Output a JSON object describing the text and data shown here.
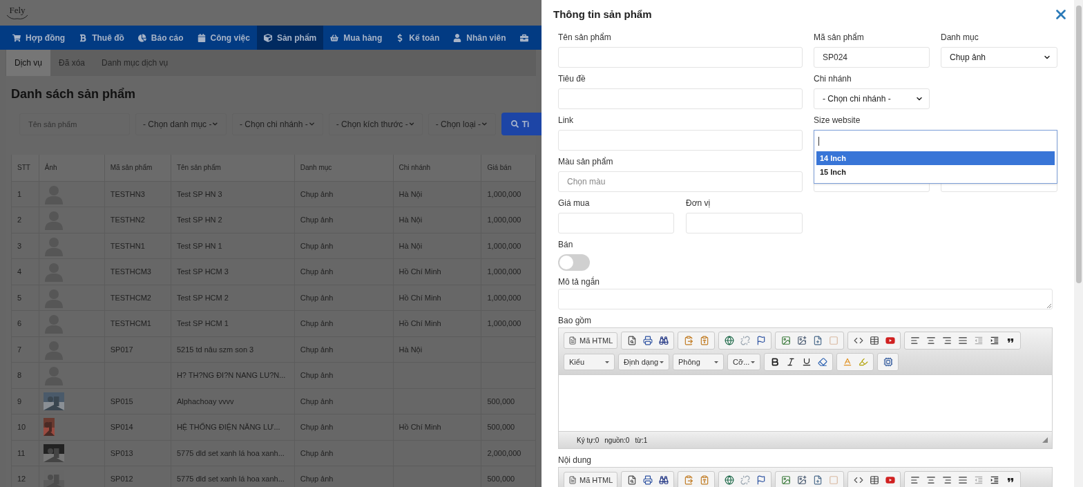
{
  "logo": {
    "text": "Fely"
  },
  "nav": [
    {
      "label": "Hợp đồng",
      "selected": false
    },
    {
      "label": "Thuê đồ",
      "selected": false
    },
    {
      "label": "Báo cáo",
      "selected": false
    },
    {
      "label": "Công việc",
      "selected": false
    },
    {
      "label": "Sản phẩm",
      "selected": true
    },
    {
      "label": "Mua hàng",
      "selected": false
    },
    {
      "label": "Kế toán",
      "selected": false
    },
    {
      "label": "Nhân viên",
      "selected": false
    },
    {
      "selected": false
    }
  ],
  "subtabs": [
    {
      "label": "Dịch vụ",
      "selected": true
    },
    {
      "label": "Đã xóa",
      "selected": false
    },
    {
      "label": "Danh mục dịch vụ",
      "selected": false
    }
  ],
  "page_title": "Danh sách sản phẩm",
  "filters": {
    "placeholder": "Tên sản phẩm",
    "selects": [
      "- Chọn danh mục -",
      "- Chọn chi nhánh -",
      "- Chọn kích thước -",
      "- Chọn loại -"
    ],
    "button": "Tì"
  },
  "table": {
    "columns": [
      "STT",
      "Ảnh",
      "Mã sản phẩm",
      "Tên sản phẩm",
      "Danh mục",
      "Chi nhánh",
      "Giá bán"
    ],
    "rows": [
      {
        "stt": "1",
        "kind": "avatar",
        "code": "TESTHN3",
        "name": "Test SP HN 3",
        "category": "Chụp ảnh",
        "branch": "Hà Nội",
        "price": "1,000,000"
      },
      {
        "stt": "2",
        "kind": "avatar",
        "code": "TESTHN2",
        "name": "Test SP HN 2",
        "category": "Chụp ảnh",
        "branch": "Hà Nội",
        "price": "1,000,000"
      },
      {
        "stt": "3",
        "kind": "avatar",
        "code": "TESTHN1",
        "name": "Test SP HN 1",
        "category": "Chụp ảnh",
        "branch": "Hà Nội",
        "price": "1,000,000"
      },
      {
        "stt": "4",
        "kind": "avatar",
        "code": "TESTHCM3",
        "name": "Test SP HCM 3",
        "category": "Chụp ảnh",
        "branch": "Hồ Chí Minh",
        "price": "1,000,000"
      },
      {
        "stt": "5",
        "kind": "avatar",
        "code": "TESTHCM2",
        "name": "Test SP HCM 2",
        "category": "Chụp ảnh",
        "branch": "Hồ Chí Minh",
        "price": "1,000,000"
      },
      {
        "stt": "6",
        "kind": "avatar",
        "code": "TESTHCM1",
        "name": "Test SP HCM 1",
        "category": "Chụp ảnh",
        "branch": "Hồ Chí Minh",
        "price": "1,000,000"
      },
      {
        "stt": "7",
        "kind": "avatar",
        "code": "SP017",
        "name": "5215 td nâu szm son 3",
        "category": "Chụp ảnh",
        "branch": "Hà Nội"
      },
      {
        "stt": "8",
        "kind": "avatar",
        "name": "H? TH?NG ÐI?N NANG LU?N...",
        "category": "Chụp ảnh"
      },
      {
        "stt": "9",
        "kind": "picture",
        "code": "SP015",
        "name": "Alphachoay vvvv",
        "category": "Chụp ảnh",
        "price": "500,000"
      },
      {
        "stt": "10",
        "kind": "picture",
        "code": "SP014",
        "name": "HỆ THỐNG ĐIỆN NĂNG LƯ...",
        "category": "Chụp ảnh",
        "branch": "Hồ Chí Minh",
        "price": "500,000"
      },
      {
        "stt": "11",
        "kind": "picture",
        "code": "SP013",
        "name": "5775 dld set xanh lá hoa xanh...",
        "category": "Chụp ảnh",
        "price": "2,000,000"
      },
      {
        "stt": "12",
        "kind": "picture",
        "code": "SP012",
        "name": "5775 dld set xanh lá hoa xanh...",
        "category": "Chụp ảnh",
        "price": "500,000"
      }
    ]
  },
  "drawer": {
    "title": "Thông tin sản phẩm",
    "name_field": {
      "label": "Tên sản phẩm"
    },
    "code_field": {
      "label": "Mã sản phẩm",
      "value": "SP024"
    },
    "category_field": {
      "label": "Danh mục",
      "value": "Chụp ảnh"
    },
    "title_field": {
      "label": "Tiêu đề"
    },
    "branch_field": {
      "label": "Chi nhánh",
      "value": "- Chọn chi nhánh -"
    },
    "link_field": {
      "label": "Link"
    },
    "size_field": {
      "label": "Size website",
      "options": [
        {
          "label": "14 Inch",
          "selected": true
        },
        {
          "label": "15 Inch",
          "selected": false
        }
      ]
    },
    "color_field": {
      "label": "Màu sản phẩm",
      "placeholder": "Chọn màu"
    },
    "buy_price_field": {
      "label": "Giá mua"
    },
    "unit_field": {
      "label": "Đơn vị"
    },
    "sell_toggle": {
      "label": "Bán",
      "on": false
    },
    "short_desc": {
      "label": "Mô tả ngắn"
    },
    "editors": [
      {
        "label": "Bao gồm",
        "source_button": "Mã HTML",
        "combos": [
          "Kiểu",
          "Định dạng",
          "Phông",
          "Cỡ..."
        ],
        "status": [
          "Ký tự:0",
          "nguồn:0",
          "từ:1"
        ]
      },
      {
        "label": "Nội dung",
        "source_button": "Mã HTML"
      }
    ]
  }
}
